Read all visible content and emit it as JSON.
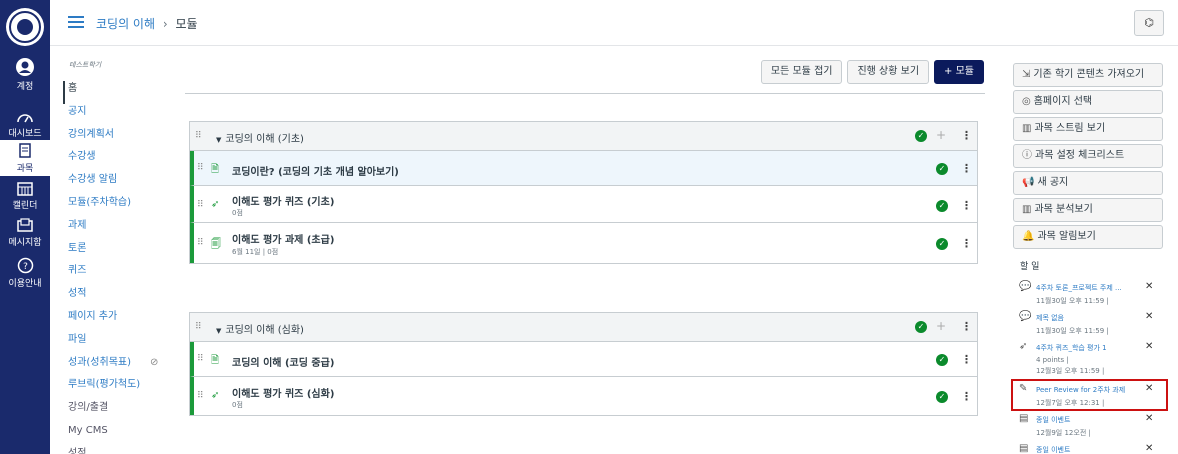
{
  "gnav": {
    "items": [
      {
        "label": "계정",
        "icon": "user-icon"
      },
      {
        "label": "대시보드",
        "icon": "dashboard-icon"
      },
      {
        "label": "과목",
        "icon": "book-icon"
      },
      {
        "label": "캘린더",
        "icon": "calendar-icon"
      },
      {
        "label": "메시지함",
        "icon": "inbox-icon"
      },
      {
        "label": "이용안내",
        "icon": "help-icon"
      }
    ]
  },
  "header": {
    "course": "코딩의 이해",
    "separator": "›",
    "page": "모듈",
    "glasses": "⌬"
  },
  "course_nav": {
    "term": "테스트학기",
    "items": [
      "홈",
      "공지",
      "강의계획서",
      "수강생",
      "수강생 알림",
      "모듈(주차학습)",
      "과제",
      "토론",
      "퀴즈",
      "성적",
      "페이지 추가",
      "파일",
      "성과(성취목표)",
      "루브릭(평가척도)",
      "강의/출결",
      "My CMS",
      "성적"
    ]
  },
  "toolbar": {
    "collapse_all": "모든 모듈 접기",
    "view_progress": "진행 상황 보기",
    "add_module": "+ 모듈"
  },
  "modules": [
    {
      "title": "코딩의 이해 (기초)",
      "items": [
        {
          "title": "코딩이란? (코딩의 기초 개념 알아보기)",
          "sub": "",
          "type": "page"
        },
        {
          "title": "이해도 평가 퀴즈 (기초)",
          "sub": "0점",
          "type": "quiz"
        },
        {
          "title": "이해도 평가 과제 (초급)",
          "sub": "6월 11일  |  0점",
          "type": "assignment"
        }
      ]
    },
    {
      "title": "코딩의 이해 (심화)",
      "items": [
        {
          "title": "코딩의 이해 (코딩 중급)",
          "sub": "",
          "type": "page"
        },
        {
          "title": "이해도 평가 퀴즈 (심화)",
          "sub": "0점",
          "type": "quiz"
        }
      ]
    }
  ],
  "sidebar": {
    "buttons": [
      {
        "label": "기존 학기 콘텐츠 가져오기",
        "icon": "import-icon"
      },
      {
        "label": "홈페이지 선택",
        "icon": "home-select-icon"
      },
      {
        "label": "과목 스트림 보기",
        "icon": "stream-icon"
      },
      {
        "label": "과목 설정 체크리스트",
        "icon": "checklist-icon"
      },
      {
        "label": "새 공지",
        "icon": "announcement-icon"
      },
      {
        "label": "과목 분석보기",
        "icon": "analytics-icon"
      },
      {
        "label": "과목 알림보기",
        "icon": "bell-icon"
      }
    ],
    "todo_heading": "할 일",
    "todos": [
      {
        "title": "4주차 토론_프로젝트 주제 ...",
        "meta": "11월30일 오후 11:59  |",
        "meta2": "",
        "icon": "discussion-icon"
      },
      {
        "title": "제목 없음",
        "meta": "11월30일 오후 11:59  |",
        "meta2": "",
        "icon": "discussion-icon"
      },
      {
        "title": "4주차 퀴즈_학습 평가 1",
        "meta": "4 points  |",
        "meta2": "12월3일 오후 11:59  |",
        "icon": "quiz-icon"
      },
      {
        "title": "Peer Review for 2주차 과제",
        "meta": "12월7일 오후 12:31  |",
        "meta2": "",
        "icon": "peer-review-icon"
      },
      {
        "title": "종일 이벤트",
        "meta": "12월9일 12오전  |",
        "meta2": "",
        "icon": "calendar-event-icon"
      },
      {
        "title": "종일 이벤트",
        "meta": "",
        "meta2": "",
        "icon": "calendar-event-icon"
      }
    ]
  }
}
